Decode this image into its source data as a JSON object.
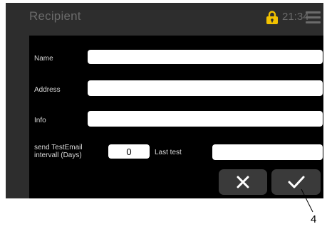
{
  "header": {
    "title": "Recipient",
    "lock_icon": "lock-icon",
    "lock_color": "#f2c200",
    "time": "21:34",
    "menu_icon": "hamburger-menu-icon"
  },
  "form": {
    "name_label": "Name",
    "name_value": "",
    "address_label": "Address",
    "address_value": "",
    "info_label": "Info",
    "info_value": "",
    "interval_label_line1": "send TestEmail",
    "interval_label_line2": "intervall (Days)",
    "interval_value": "0",
    "last_test_label": "Last test",
    "last_test_value": ""
  },
  "buttons": {
    "cancel_icon": "close-icon",
    "confirm_icon": "checkmark-icon"
  },
  "annotation": {
    "callout_number": "4"
  }
}
